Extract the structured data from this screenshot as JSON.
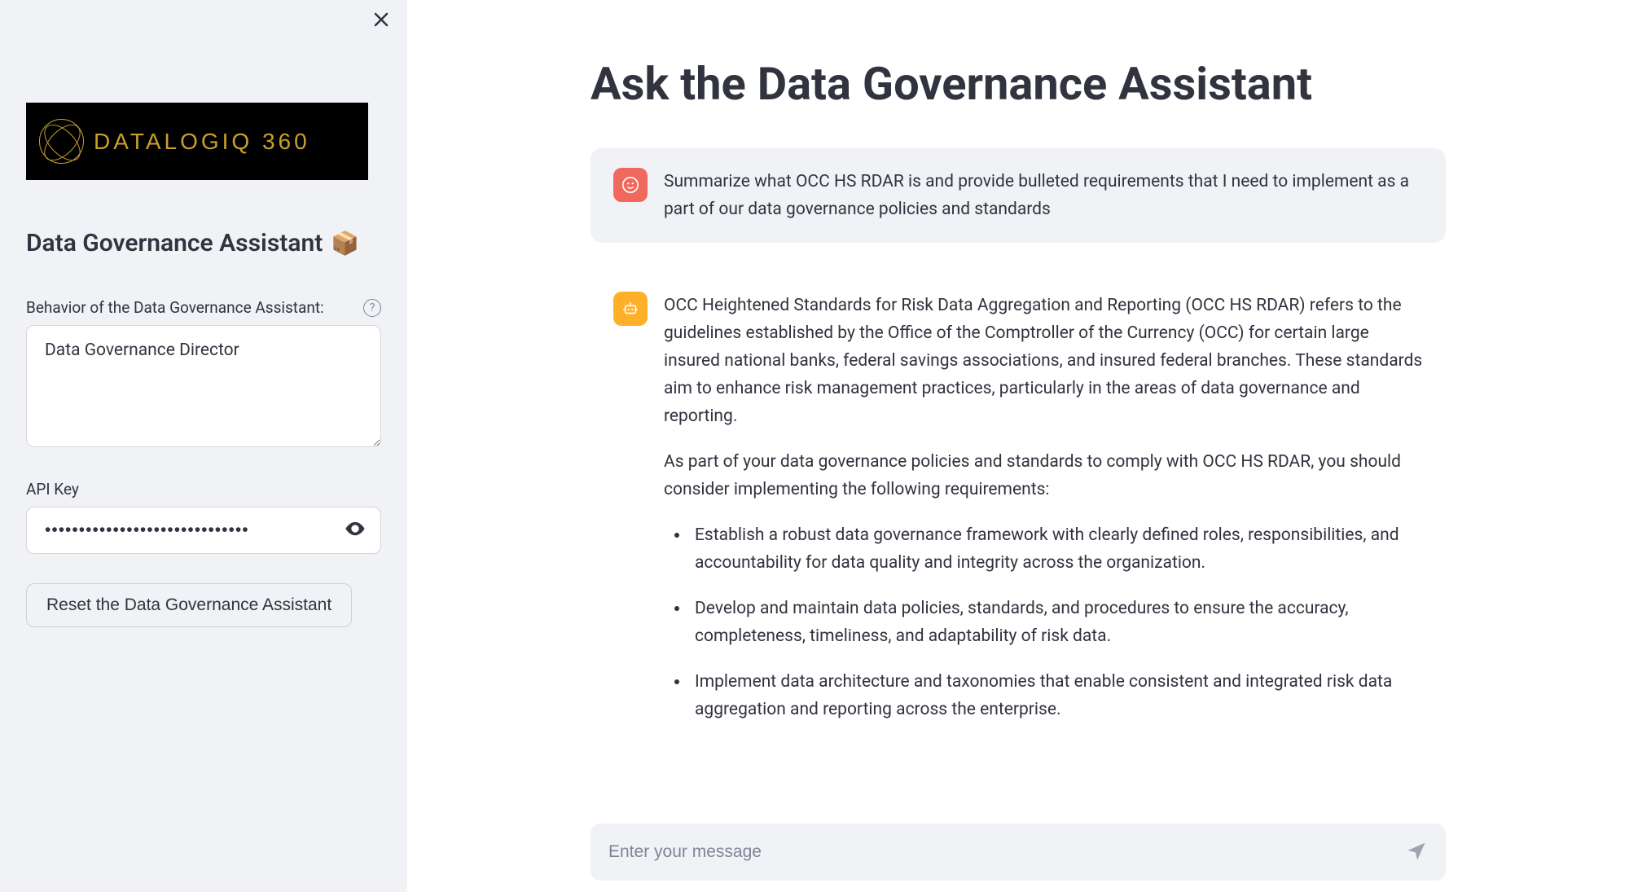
{
  "sidebar": {
    "logo_text": "DATALOGIQ 360",
    "title": "Data Governance Assistant",
    "title_emoji": "📦",
    "behavior_label": "Behavior of the Data Governance Assistant:",
    "behavior_value": "Data Governance Director",
    "api_key_label": "API Key",
    "api_key_value": "••••••••••••••••••••••••••••••",
    "reset_label": "Reset the Data Governance Assistant"
  },
  "main": {
    "title": "Ask the Data Governance Assistant",
    "chat_placeholder": "Enter your message",
    "user_message": "Summarize what OCC HS RDAR is and provide bulleted requirements that I need to implement as a part of our data governance policies and standards",
    "assistant_message": {
      "p1": "OCC Heightened Standards for Risk Data Aggregation and Reporting (OCC HS RDAR) refers to the guidelines established by the Office of the Comptroller of the Currency (OCC) for certain large insured national banks, federal savings associations, and insured federal branches. These standards aim to enhance risk management practices, particularly in the areas of data governance and reporting.",
      "p2": "As part of your data governance policies and standards to comply with OCC HS RDAR, you should consider implementing the following requirements:",
      "bullets": [
        "Establish a robust data governance framework with clearly defined roles, responsibilities, and accountability for data quality and integrity across the organization.",
        "Develop and maintain data policies, standards, and procedures to ensure the accuracy, completeness, timeliness, and adaptability of risk data.",
        "Implement data architecture and taxonomies that enable consistent and integrated risk data aggregation and reporting across the enterprise."
      ]
    }
  }
}
